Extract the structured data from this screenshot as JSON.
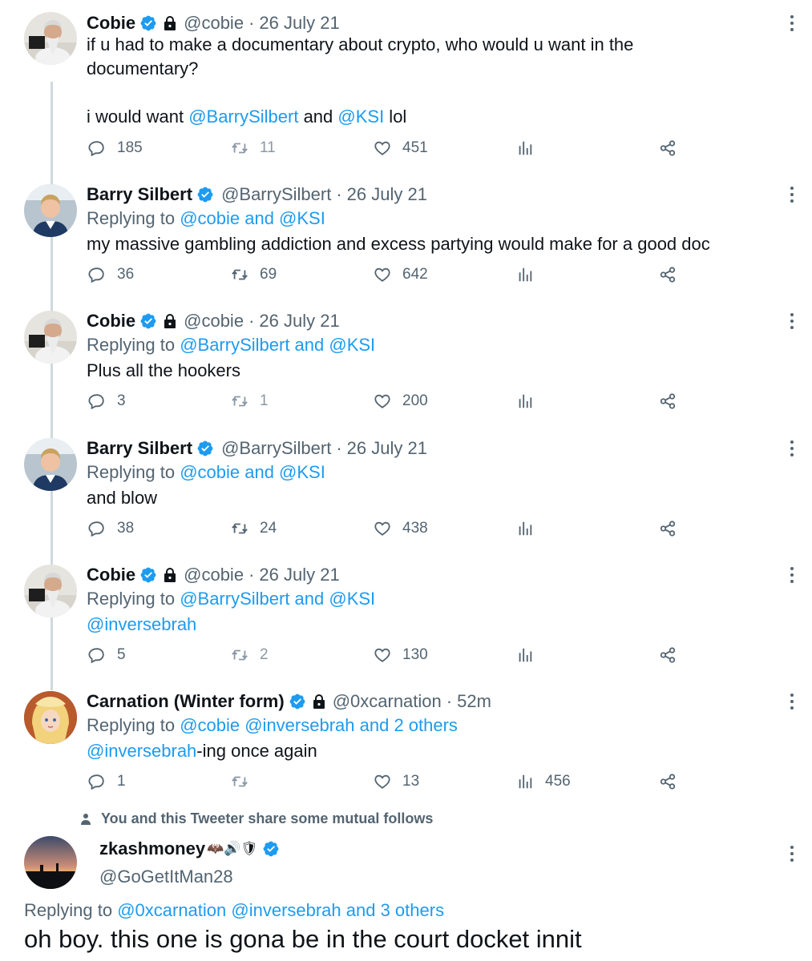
{
  "tweets": [
    {
      "name": "Cobie",
      "verified": true,
      "protected": true,
      "handle": "@cobie",
      "date": "26 July 21",
      "replying": null,
      "body": {
        "line1": "if u had to make a documentary about crypto, who would u want in the",
        "line2": "documentary?",
        "line3_pre": "i would want ",
        "mention1": "@BarrySilbert",
        "mid": " and ",
        "mention2": "@KSI",
        "post": " lol"
      },
      "stats": {
        "replies": "185",
        "retweets": "11",
        "likes": "451",
        "views": ""
      }
    },
    {
      "name": "Barry Silbert",
      "verified": true,
      "protected": false,
      "handle": "@BarrySilbert",
      "date": "26 July 21",
      "replying": {
        "prefix": "Replying to ",
        "targets": "@cobie and @KSI"
      },
      "text": "my massive gambling addiction and excess partying would make for a good doc",
      "stats": {
        "replies": "36",
        "retweets": "69",
        "likes": "642",
        "views": ""
      }
    },
    {
      "name": "Cobie",
      "verified": true,
      "protected": true,
      "handle": "@cobie",
      "date": "26 July 21",
      "replying": {
        "prefix": "Replying to ",
        "targets": "@BarrySilbert and @KSI"
      },
      "text": "Plus all the hookers",
      "stats": {
        "replies": "3",
        "retweets": "1",
        "likes": "200",
        "views": ""
      }
    },
    {
      "name": "Barry Silbert",
      "verified": true,
      "protected": false,
      "handle": "@BarrySilbert",
      "date": "26 July 21",
      "replying": {
        "prefix": "Replying to ",
        "targets": "@cobie and @KSI"
      },
      "text": "and blow",
      "stats": {
        "replies": "38",
        "retweets": "24",
        "likes": "438",
        "views": ""
      }
    },
    {
      "name": "Cobie",
      "verified": true,
      "protected": true,
      "handle": "@cobie",
      "date": "26 July 21",
      "replying": {
        "prefix": "Replying to ",
        "targets": "@BarrySilbert and @KSI"
      },
      "mention": "@inversebrah",
      "stats": {
        "replies": "5",
        "retweets": "2",
        "likes": "130",
        "views": ""
      }
    },
    {
      "name": "Carnation (Winter form)",
      "verified": true,
      "protected": true,
      "handle": "@0xcarnation",
      "date": "52m",
      "replying": {
        "prefix": "Replying to ",
        "targets": "@cobie @inversebrah and 2 others"
      },
      "mention": "@inversebrah",
      "text_after": "-ing once again",
      "stats": {
        "replies": "1",
        "retweets": "",
        "likes": "13",
        "views": "456"
      }
    }
  ],
  "mutual_notice": "You and this Tweeter share some mutual follows",
  "final_tweet": {
    "name": "zkashmoney",
    "name_emoji": "🦇🔊🛡",
    "verified": true,
    "handle": "@GoGetItMan28",
    "replying": {
      "prefix": "Replying to ",
      "targets": "@0xcarnation @inversebrah and 3 others"
    },
    "text": "oh boy. this one is gona be in the court docket innit"
  },
  "colors": {
    "accent": "#1d9bf0",
    "secondary_text": "#536471",
    "thread_line": "#cfd9de"
  }
}
